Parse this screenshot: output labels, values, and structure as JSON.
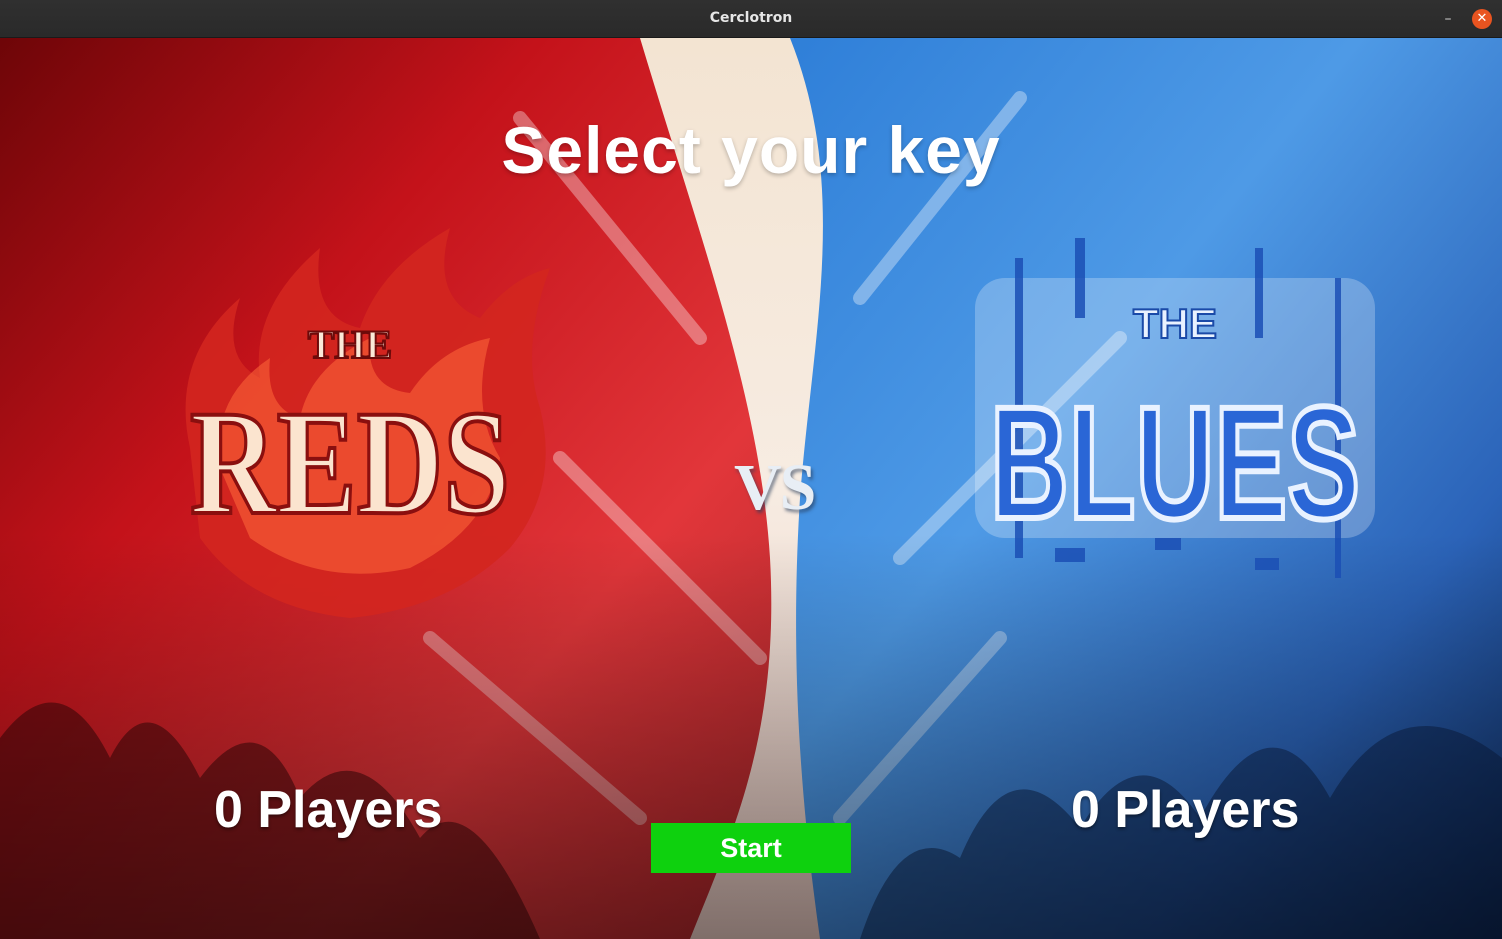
{
  "window": {
    "title": "Cerclotron"
  },
  "screen": {
    "heading": "Select your key",
    "vs_label": "VS",
    "red_team": {
      "logo_small": "THE",
      "logo_big": "REDS",
      "player_count": "0 Players",
      "color": "#d9161b"
    },
    "blue_team": {
      "logo_small": "THE",
      "logo_big": "BLUES",
      "player_count": "0 Players",
      "color": "#1f6fd6"
    },
    "start_label": "Start",
    "start_color": "#0ed10e"
  },
  "icons": {
    "minimize": "minimize-icon",
    "close": "close-icon"
  }
}
